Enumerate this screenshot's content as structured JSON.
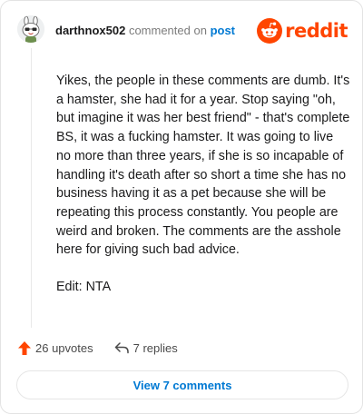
{
  "header": {
    "username": "darthnox502",
    "action_text": "commented on",
    "post_link": "post",
    "logo_text": "reddit"
  },
  "comment": {
    "paragraphs": [
      "Yikes, the people in these comments are dumb. It's a hamster, she had it for a year. Stop saying \"oh, but imagine it was her best friend\" - that's complete BS, it was a fucking hamster. It was going to live no more than three years, if she is so incapable of handling it's death after so short a time she has no business having it as a pet because she will be repeating this process constantly. You people are weird and broken. The comments are the asshole here for giving such bad advice.",
      "Edit: NTA"
    ]
  },
  "actions": {
    "upvotes_label": "26 upvotes",
    "replies_label": "7 replies"
  },
  "view_comments_label": "View 7 comments",
  "colors": {
    "brand": "#ff4500",
    "link": "#0079d3",
    "upvote": "#ff4500"
  }
}
